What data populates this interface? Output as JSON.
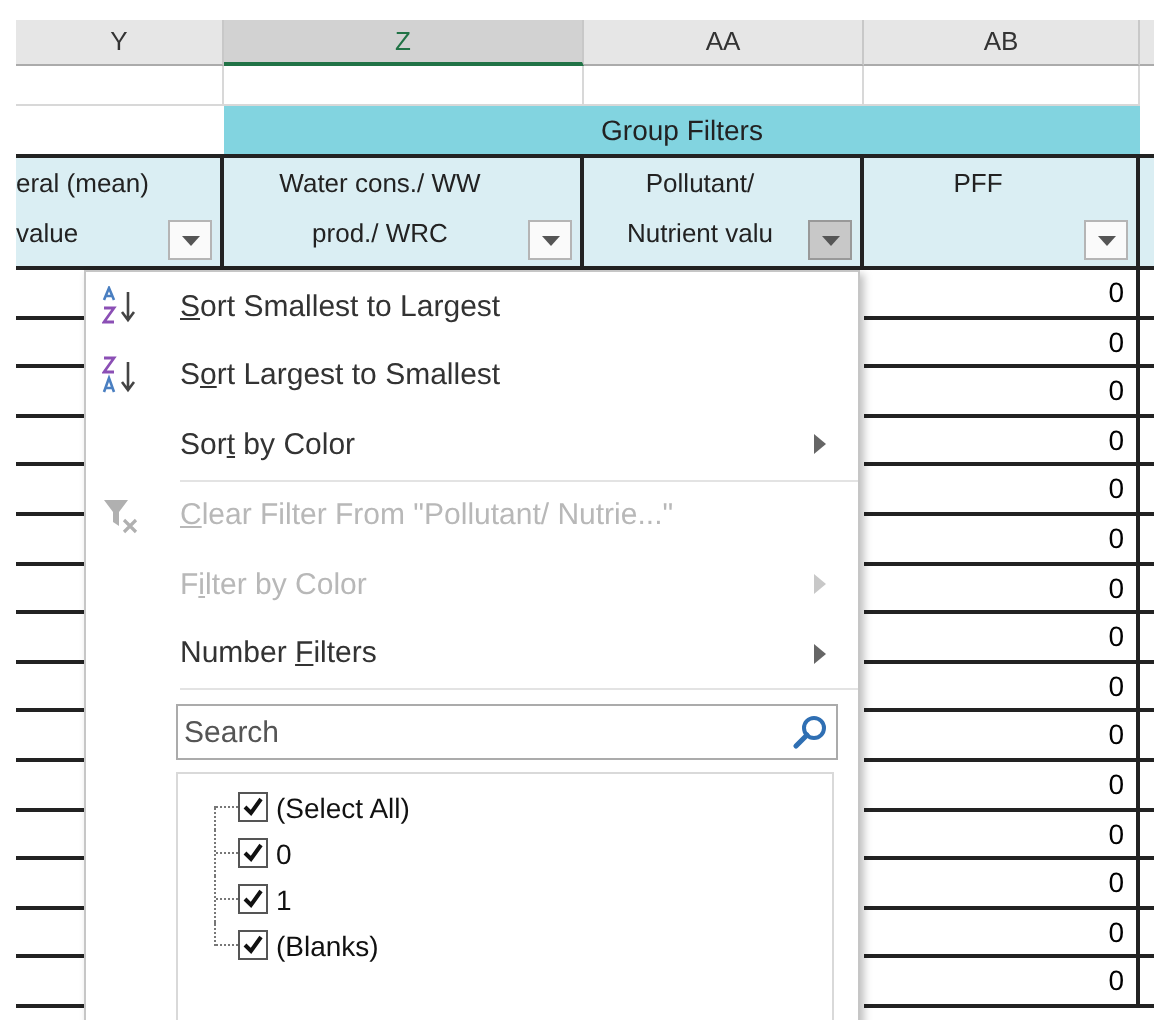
{
  "columns": [
    {
      "label": "Y",
      "selected": false
    },
    {
      "label": "Z",
      "selected": true
    },
    {
      "label": "AA",
      "selected": false
    },
    {
      "label": "AB",
      "selected": false
    }
  ],
  "group_header": "Group Filters",
  "headers": [
    {
      "lines": [
        "eral (mean)",
        "value"
      ],
      "filter_active": false
    },
    {
      "lines": [
        "Water cons./ WW",
        "prod./ WRC"
      ],
      "filter_active": false
    },
    {
      "lines": [
        "Pollutant/",
        "Nutrient valu"
      ],
      "filter_active": true
    },
    {
      "lines": [
        "PFF"
      ],
      "filter_active": false
    }
  ],
  "rows": [
    {
      "pff": "0"
    },
    {
      "pff": "0"
    },
    {
      "pff": "0"
    },
    {
      "pff": "0"
    },
    {
      "pff": "0"
    },
    {
      "pff": "0"
    },
    {
      "pff": "0"
    },
    {
      "pff": "0"
    },
    {
      "pff": "0"
    },
    {
      "pff": "0"
    },
    {
      "pff": "0"
    },
    {
      "pff": "0"
    },
    {
      "pff": "0"
    },
    {
      "pff": "0"
    },
    {
      "pff": "0"
    }
  ],
  "filter_menu": {
    "items": [
      {
        "label": {
          "key": "S",
          "after": "ort Smallest to Largest"
        },
        "disabled": false,
        "submenu": false,
        "separator_after": false
      },
      {
        "label": {
          "before": "S",
          "key": "o",
          "after": "rt Largest to Smallest"
        },
        "disabled": false,
        "submenu": false,
        "separator_after": false
      },
      {
        "label": {
          "before": "Sor",
          "key": "t",
          "after": " by Color"
        },
        "disabled": false,
        "submenu": true,
        "separator_after": true
      },
      {
        "label": {
          "key": "C",
          "after": "lear Filter From \"Pollutant/ Nutrie...\""
        },
        "disabled": true,
        "submenu": false,
        "separator_after": false
      },
      {
        "label": {
          "before": "F",
          "key": "i",
          "after": "lter by Color"
        },
        "disabled": true,
        "submenu": true,
        "separator_after": false
      },
      {
        "label": {
          "before": "Number ",
          "key": "F",
          "after": "ilters"
        },
        "disabled": false,
        "submenu": true,
        "separator_after": true
      }
    ],
    "search": {
      "placeholder": "Search"
    },
    "values": [
      {
        "label": "(Select All)",
        "checked": true
      },
      {
        "label": "0",
        "checked": true
      },
      {
        "label": "1",
        "checked": true
      },
      {
        "label": "(Blanks)",
        "checked": true
      }
    ]
  }
}
